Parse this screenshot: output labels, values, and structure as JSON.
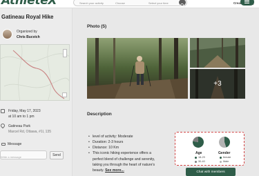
{
  "header": {
    "logo": "Athlete",
    "logo_accent": "X",
    "search_fields": [
      "Search your activity",
      "Choose",
      "Select your time"
    ],
    "create_label": "Create activity",
    "colors": {
      "brand": "#2f5d49",
      "accent_red": "#d24343"
    }
  },
  "sidebar": {
    "event_title": "Gatineau Royal Hike",
    "organized_label": "Organized by",
    "organizer": "Chris Bucvich",
    "date_line1": "Friday, May 17, 2023",
    "date_line2": "at 10 am to 1 pm",
    "location_line1": "Gatineau Park",
    "location_line2": "Marcel Rd, Ottawa, #1l, 135",
    "message_label": "Message",
    "message_placeholder": "Write a message",
    "send_label": "Send",
    "icons": {
      "date": "calendar-icon",
      "location": "map-pin-icon",
      "message": "message-icon"
    }
  },
  "photos": {
    "title": "Photo (5)",
    "more_label": "+3"
  },
  "description": {
    "title": "Description",
    "items": [
      "level of activity: Moderate",
      "Duration: 2-3 hours",
      "Distance: 10 Km",
      "This iconic hiking experience offers a"
    ],
    "extra_lines": [
      "perfect blend of challenge and serenity,",
      "taking you through the heart of nature's"
    ],
    "last_line": "beauty.",
    "see_more": "See more..."
  },
  "stats": {
    "age": {
      "title": "Age",
      "legend": [
        {
          "label": "18-29",
          "color": "#2f5d49"
        },
        {
          "label": "30-40",
          "color": "#7d7d7d"
        }
      ],
      "shares": [
        0.78,
        0.22
      ]
    },
    "gender": {
      "title": "Gender",
      "legend": [
        {
          "label": "female",
          "color": "#2f5d49"
        },
        {
          "label": "Male",
          "color": "#b3b3b3"
        }
      ],
      "shares": [
        0.45,
        0.55
      ]
    }
  },
  "chat_button": "Chat with members"
}
